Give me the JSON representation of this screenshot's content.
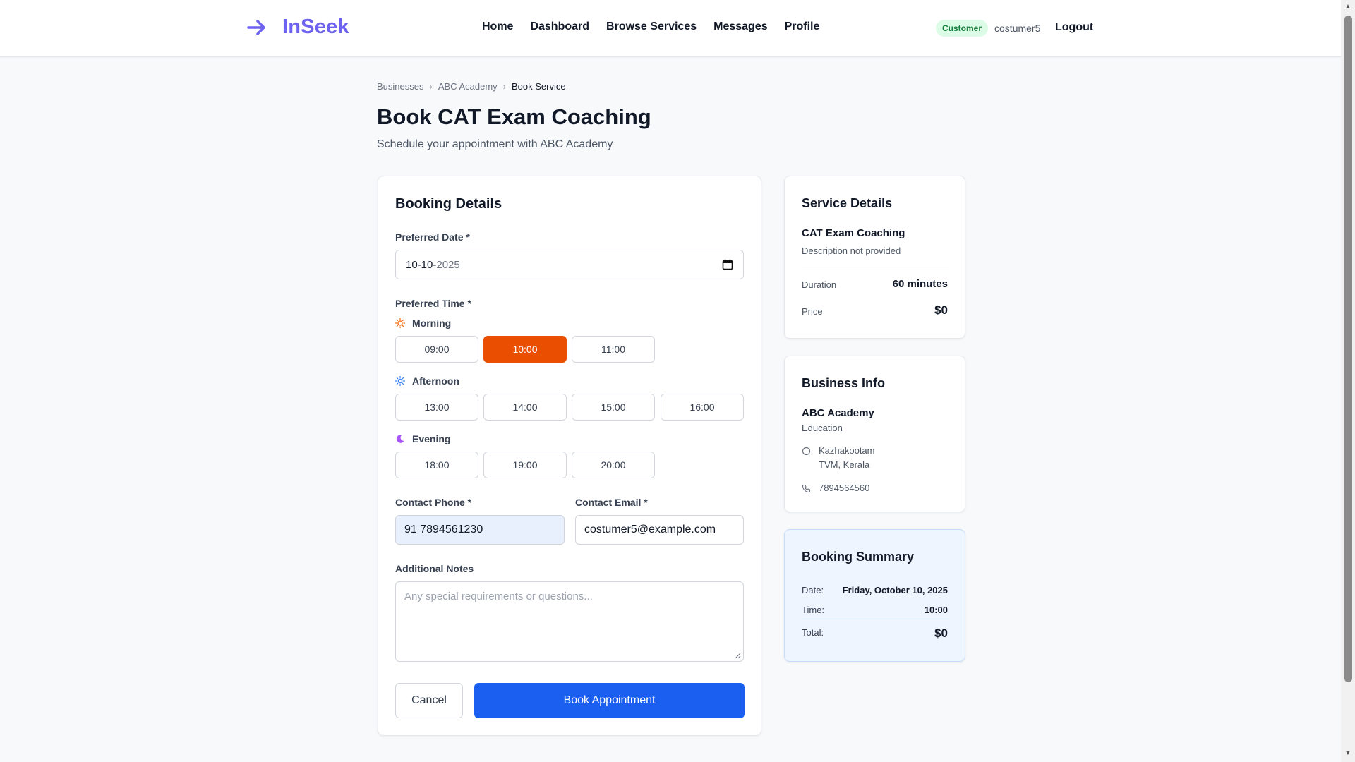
{
  "header": {
    "logo_text": "InSeek",
    "nav": [
      "Home",
      "Dashboard",
      "Browse Services",
      "Messages",
      "Profile"
    ],
    "role_badge": "Customer",
    "username": "costumer5",
    "logout_label": "Logout"
  },
  "breadcrumb": {
    "items": [
      "Businesses",
      "ABC Academy",
      "Book Service"
    ],
    "separator": "›"
  },
  "page": {
    "title": "Book CAT Exam Coaching",
    "subtitle": "Schedule your appointment with ABC Academy"
  },
  "booking": {
    "title": "Booking Details",
    "date_label": "Preferred Date *",
    "date_day_month": "10-10-",
    "date_year": "2025",
    "time_label": "Preferred Time *",
    "periods": {
      "morning": {
        "label": "Morning",
        "slots": [
          "09:00",
          "10:00",
          "11:00"
        ]
      },
      "afternoon": {
        "label": "Afternoon",
        "slots": [
          "13:00",
          "14:00",
          "15:00",
          "16:00"
        ]
      },
      "evening": {
        "label": "Evening",
        "slots": [
          "18:00",
          "19:00",
          "20:00"
        ]
      }
    },
    "selected_slot": "10:00",
    "phone_label": "Contact Phone *",
    "phone_value": "91 7894561230",
    "email_label": "Contact Email *",
    "email_value": "costumer5@example.com",
    "notes_label": "Additional Notes",
    "notes_placeholder": "Any special requirements or questions...",
    "cancel_label": "Cancel",
    "submit_label": "Book Appointment"
  },
  "service": {
    "title": "Service Details",
    "name": "CAT Exam Coaching",
    "description": "Description not provided",
    "duration_label": "Duration",
    "duration_value": "60 minutes",
    "price_label": "Price",
    "price_value": "$0"
  },
  "business": {
    "title": "Business Info",
    "name": "ABC Academy",
    "category": "Education",
    "address_line1": "Kazhakootam",
    "address_line2": "TVM, Kerala",
    "phone": "7894564560"
  },
  "summary": {
    "title": "Booking Summary",
    "date_label": "Date:",
    "date_value": "Friday, October 10, 2025",
    "time_label": "Time:",
    "time_value": "10:00",
    "total_label": "Total:",
    "total_value": "$0"
  },
  "colors": {
    "accent": "#1a5ff0",
    "selected_slot": "#ea4e00",
    "logo": "#6d63f0"
  }
}
